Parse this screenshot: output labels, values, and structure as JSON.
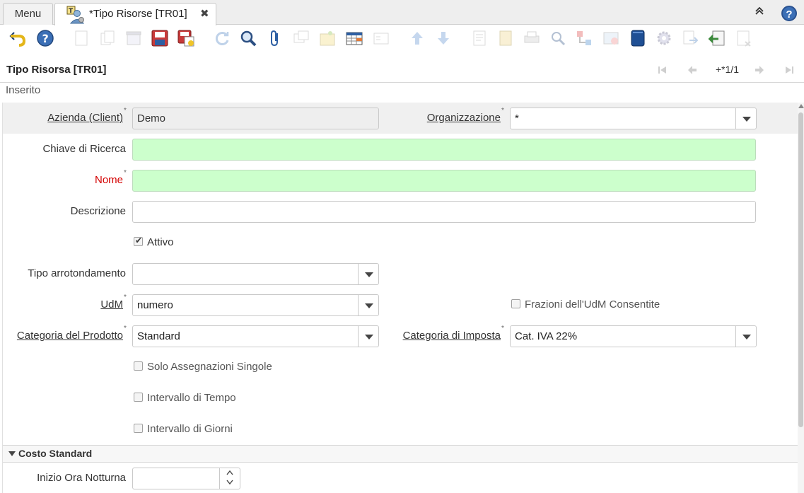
{
  "tabs": {
    "menu_label": "Menu",
    "active_label": "*Tipo Risorse [TR01]",
    "close_icon": "close-icon"
  },
  "toolbar": {
    "buttons": [
      {
        "name": "undo-icon",
        "enabled": true
      },
      {
        "name": "help-icon",
        "enabled": true
      },
      {
        "name": "new-record-icon",
        "enabled": false
      },
      {
        "name": "copy-record-icon",
        "enabled": false
      },
      {
        "name": "delete-icon",
        "enabled": false
      },
      {
        "name": "save-icon",
        "enabled": true
      },
      {
        "name": "save-create-icon",
        "enabled": true
      },
      {
        "name": "refresh-icon",
        "enabled": false
      },
      {
        "name": "find-icon",
        "enabled": true
      },
      {
        "name": "attachment-icon",
        "enabled": true
      },
      {
        "name": "chat-icon",
        "enabled": false
      },
      {
        "name": "archive-icon",
        "enabled": false
      },
      {
        "name": "grid-toggle-icon",
        "enabled": true
      },
      {
        "name": "multi-record-icon",
        "enabled": false
      },
      {
        "name": "arrow-up-icon",
        "enabled": false
      },
      {
        "name": "arrow-down-icon",
        "enabled": false
      },
      {
        "name": "report-icon",
        "enabled": false
      },
      {
        "name": "history-icon",
        "enabled": false
      },
      {
        "name": "print-icon",
        "enabled": false
      },
      {
        "name": "zoom-across-icon",
        "enabled": false
      },
      {
        "name": "workflow-icon",
        "enabled": false
      },
      {
        "name": "requests-icon",
        "enabled": false
      },
      {
        "name": "product-info-icon",
        "enabled": true
      },
      {
        "name": "process-icon",
        "enabled": false
      },
      {
        "name": "export-icon",
        "enabled": false
      },
      {
        "name": "import-icon",
        "enabled": true
      },
      {
        "name": "quick-form-icon",
        "enabled": false
      }
    ]
  },
  "title": "Tipo Risorsa [TR01]",
  "record_counter": "+*1/1",
  "status": "Inserito",
  "form": {
    "client_label": "Azienda (Client)",
    "client_value": "Demo",
    "org_label": "Organizzazione",
    "org_value": "*",
    "search_key_label": "Chiave di Ricerca",
    "search_key_value": "",
    "name_label": "Nome",
    "name_value": "",
    "description_label": "Descrizione",
    "description_value": "",
    "active_label": "Attivo",
    "active_checked": true,
    "rounding_label": "Tipo arrotondamento",
    "rounding_value": "",
    "uom_label": "UdM",
    "uom_value": "numero",
    "fractions_label": "Frazioni dell'UdM Consentite",
    "fractions_checked": false,
    "product_category_label": "Categoria del Prodotto",
    "product_category_value": "Standard",
    "tax_category_label": "Categoria di Imposta",
    "tax_category_value": "Cat. IVA 22%",
    "single_assignment_label": "Solo Assegnazioni Singole",
    "single_assignment_checked": false,
    "time_slot_label": "Intervallo di Tempo",
    "time_slot_checked": false,
    "day_slot_label": "Intervallo di Giorni",
    "day_slot_checked": false
  },
  "section": {
    "title": "Costo Standard",
    "night_start_label": "Inizio Ora Notturna",
    "night_start_value": ""
  },
  "colors": {
    "required_label": "#d40000",
    "mandatory_field_bg": "#ccffcc",
    "readonly_field_bg": "#eeeeee"
  }
}
